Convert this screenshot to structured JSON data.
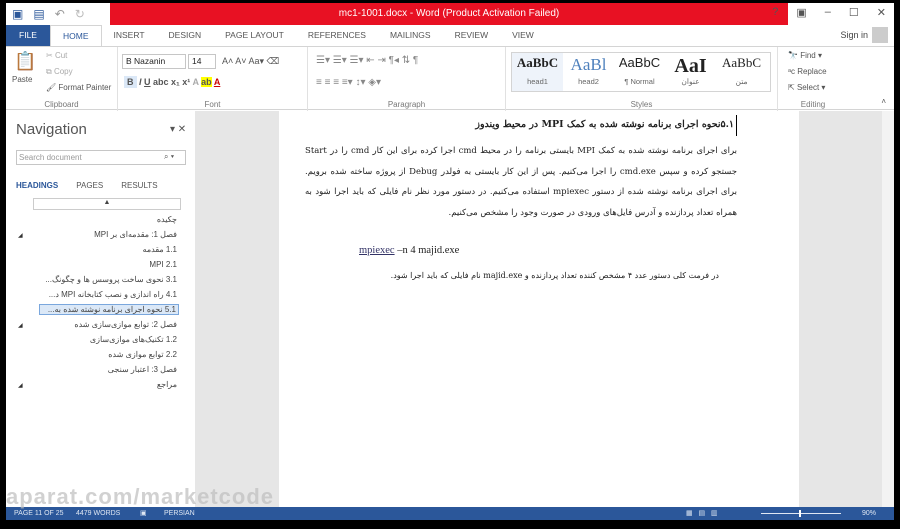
{
  "window": {
    "title": "mc1-1001.docx - Word (Product Activation Failed)",
    "controls": [
      "?",
      "▣",
      "–",
      "☐",
      "✕"
    ]
  },
  "tabs": [
    "FILE",
    "HOME",
    "INSERT",
    "DESIGN",
    "PAGE LAYOUT",
    "REFERENCES",
    "MAILINGS",
    "REVIEW",
    "VIEW"
  ],
  "sign_in": "Sign in",
  "clipboard": {
    "paste": "Paste",
    "cut": "Cut",
    "copy": "Copy",
    "format_painter": "Format Painter",
    "label": "Clipboard"
  },
  "font": {
    "name": "B Nazanin",
    "size": "14",
    "label": "Font"
  },
  "paragraph": {
    "label": "Paragraph"
  },
  "styles": {
    "label": "Styles",
    "items": [
      {
        "sample": "AaBbC",
        "name": "head1"
      },
      {
        "sample": "AaBl",
        "name": "head2"
      },
      {
        "sample": "AaBbC",
        "name": "¶ Normal"
      },
      {
        "sample": "AaI",
        "name": "عنوان"
      },
      {
        "sample": "AaBbC",
        "name": "متن"
      }
    ]
  },
  "editing": {
    "find": "Find",
    "replace": "Replace",
    "select": "Select",
    "label": "Editing"
  },
  "navigation": {
    "title": "Navigation",
    "search_placeholder": "Search document",
    "tabs": [
      "HEADINGS",
      "PAGES",
      "RESULTS"
    ],
    "headings": [
      "چکیده",
      "فصل 1: مقدمه‌ای بر MPI",
      "1.1 مقدمه",
      "MPI 2.1",
      "3.1 نحوی ساخت پروسس ها و چگونگ...",
      "4.1 راه اندازی و نصب کتابخانه MPI د...",
      "5.1 نحوه اجرای برنامه نوشته شده به...",
      "فصل 2: توابع موازی‌سازی شده",
      "1.2 تکنیک‌های موازی‌سازی",
      "2.2 توابع موازی شده",
      "فصل 3: اعتبار سنجی",
      "مراجع"
    ]
  },
  "document": {
    "heading": "۵.۱نحوه اجرای برنامه نوشته شده به کمک MPI در محیط ویندوز",
    "paragraph": "برای اجرای برنامه نوشته شده به کمک MPI بایستی برنامه را در محیط cmd اجرا کرده برای این کار cmd را در Start جستجو کرده و سپس cmd.exe را اجرا می‌کنیم. پس از این کار بایستی به فولدر Debug از پروژه ساخته شده برویم. برای اجرای برنامه نوشته شده از دستور mpiexec استفاده می‌کنیم. در دستور مورد نظر نام فایلی که باید اجرا شود به همراه تعداد پردازنده و آدرس فایل‌های ورودی در صورت وجود را مشخص می‌کنیم.",
    "command_word": "mpiexec",
    "command_rest": " –n 4 majid.exe",
    "note": "در فرمت کلی دستور عدد ۴ مشخص کننده تعداد پردازنده و majid.exe نام فایلی که باید اجرا شود."
  },
  "status": {
    "page": "PAGE 11 OF 25",
    "words": "4479 WORDS",
    "language": "PERSIAN",
    "zoom": "90%"
  },
  "watermark": "aparat.com/marketcode"
}
